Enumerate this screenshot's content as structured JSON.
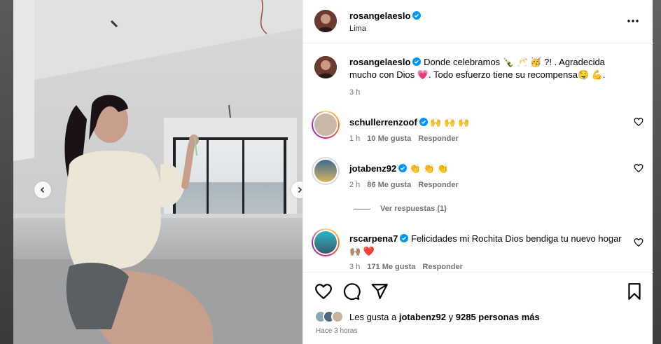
{
  "post": {
    "username": "rosangelaeslo",
    "location": "Lima",
    "caption": {
      "username": "rosangelaeslo",
      "text": "Donde celebramos 🍾 🥂 🥳 ?! . Agradecida mucho con Dios 💗. Todo esfuerzo tiene su recompensa🤤 💪.",
      "time": "3 h"
    }
  },
  "comments": [
    {
      "username": "schullerrenzoof",
      "text": "🙌 🙌 🙌",
      "time": "1 h",
      "likes": "10 Me gusta",
      "reply": "Responder"
    },
    {
      "username": "jotabenz92",
      "text": "👏 👏 👏",
      "time": "2 h",
      "likes": "86 Me gusta",
      "reply": "Responder"
    },
    {
      "username": "rscarpena7",
      "text": "Felicidades mi Rochita Dios bendiga tu nuevo hogar 🙌🏽 ❤️",
      "time": "3 h",
      "likes": "171 Me gusta",
      "reply": "Responder"
    }
  ],
  "view_replies": "Ver respuestas (1)",
  "likes_summary": {
    "prefix": "Les gusta a ",
    "user": "jotabenz92",
    "middle": " y ",
    "others": "9285 personas más"
  },
  "posted_ago": "Hace 3 horas",
  "icons": [
    "more-options-icon",
    "heart-icon",
    "comment-icon",
    "share-icon",
    "bookmark-icon",
    "verified-badge-icon",
    "chevron-left-icon",
    "chevron-right-icon"
  ],
  "colors": {
    "verified": "#0095f6",
    "muted": "#737373",
    "border": "#efefef"
  }
}
